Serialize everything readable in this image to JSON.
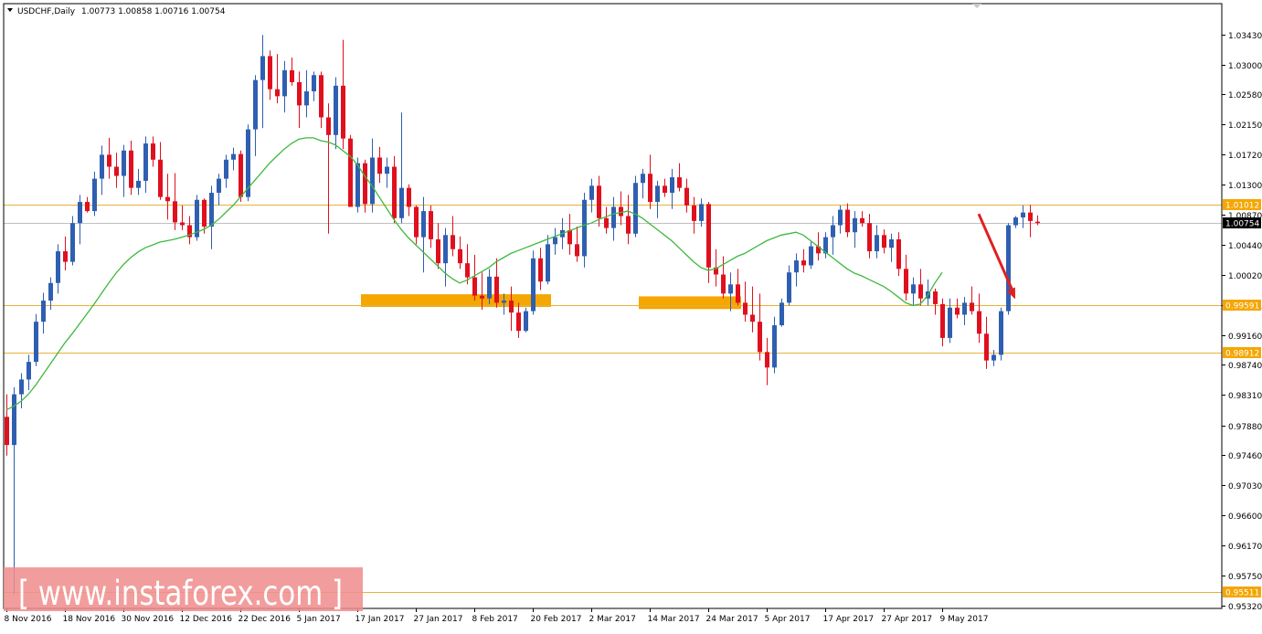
{
  "colors": {
    "bull": "#2f5fb0",
    "bear": "#e0101e",
    "wick_bull": "#2f5fb0",
    "wick_bear": "#e0101e",
    "ma": "#3fb83f",
    "level_line": "#e8b23a",
    "level_label_bg": "#f5a600",
    "zone": "#f5a600",
    "arrow": "#e02020",
    "price_label_bg": "#000000",
    "watermark_bg": "#f08c8c"
  },
  "header": {
    "symbol_label": "USDCHF,Daily",
    "ohlc": "1.00773 1.00858 1.00716 1.00754"
  },
  "watermark": {
    "text": "[ www.instaforex.com ]"
  },
  "chart_data": {
    "type": "candlestick",
    "symbol": "USDCHF",
    "timeframe": "Daily",
    "ylim": [
      0.9532,
      1.0372
    ],
    "y_ticks": [
      "1.03430",
      "1.03000",
      "1.02580",
      "1.02150",
      "1.01720",
      "1.01300",
      "1.00870",
      "1.00440",
      "1.00020",
      "0.99591",
      "0.99160",
      "0.98740",
      "0.98310",
      "0.97880",
      "0.97460",
      "0.97030",
      "0.96600",
      "0.96170",
      "0.95750",
      "0.95320"
    ],
    "x_ticks": [
      "8 Nov 2016",
      "18 Nov 2016",
      "30 Nov 2016",
      "12 Dec 2016",
      "22 Dec 2016",
      "5 Jan 2017",
      "17 Jan 2017",
      "27 Jan 2017",
      "8 Feb 2017",
      "20 Feb 2017",
      "2 Mar 2017",
      "14 Mar 2017",
      "24 Mar 2017",
      "5 Apr 2017",
      "17 Apr 2017",
      "27 Apr 2017",
      "9 May 2017"
    ],
    "x_tick_index": [
      0,
      8,
      16,
      24,
      32,
      40,
      48,
      56,
      64,
      72,
      80,
      88,
      96,
      104,
      112,
      120,
      128
    ],
    "current_price": "1.00754",
    "current_price_value": 1.00754,
    "levels": [
      {
        "label": "1.01012",
        "value": 1.01012
      },
      {
        "label": "0.99591",
        "value": 0.99591
      },
      {
        "label": "0.98912",
        "value": 0.98912
      },
      {
        "label": "0.95511",
        "value": 0.95511
      }
    ],
    "zones": [
      {
        "from_index": 48.5,
        "to_index": 74.5,
        "low": 0.9956,
        "high": 0.9974
      },
      {
        "from_index": 86.5,
        "to_index": 100.5,
        "low": 0.9953,
        "high": 0.9971
      }
    ],
    "arrow": {
      "from_index": 133,
      "from_price": 1.0088,
      "to_index": 138,
      "to_price": 0.9967
    },
    "candles": [
      [
        0.98,
        0.9832,
        0.9745,
        0.976
      ],
      [
        0.976,
        0.9842,
        0.9548,
        0.9832
      ],
      [
        0.9832,
        0.9862,
        0.9812,
        0.9853
      ],
      [
        0.9853,
        0.9888,
        0.9838,
        0.9878
      ],
      [
        0.9878,
        0.9946,
        0.9872,
        0.9935
      ],
      [
        0.9935,
        0.9976,
        0.9918,
        0.9965
      ],
      [
        0.9965,
        0.9998,
        0.9952,
        0.999
      ],
      [
        0.999,
        1.0045,
        0.9975,
        1.0035
      ],
      [
        1.0035,
        1.0056,
        1.0008,
        1.002
      ],
      [
        1.002,
        1.0085,
        1.0015,
        1.0075
      ],
      [
        1.0075,
        1.0115,
        1.0045,
        1.0105
      ],
      [
        1.0105,
        1.0112,
        1.009,
        1.0092
      ],
      [
        1.0092,
        1.0148,
        1.0085,
        1.0138
      ],
      [
        1.0138,
        1.0185,
        1.0115,
        1.0172
      ],
      [
        1.0172,
        1.0196,
        1.0138,
        1.0155
      ],
      [
        1.0155,
        1.0175,
        1.0125,
        1.0142
      ],
      [
        1.0142,
        1.0186,
        1.0112,
        1.0178
      ],
      [
        1.0178,
        1.0192,
        1.0115,
        1.0125
      ],
      [
        1.0125,
        1.0152,
        1.0115,
        1.0135
      ],
      [
        1.0135,
        1.0198,
        1.0118,
        1.0188
      ],
      [
        1.0188,
        1.0198,
        1.0155,
        1.0165
      ],
      [
        1.0165,
        1.019,
        1.0108,
        1.0112
      ],
      [
        1.0112,
        1.0145,
        1.008,
        1.0106
      ],
      [
        1.0106,
        1.0146,
        1.0065,
        1.0076
      ],
      [
        1.0076,
        1.01,
        1.0065,
        1.0072
      ],
      [
        1.0072,
        1.0085,
        1.0045,
        1.0055
      ],
      [
        1.0055,
        1.0115,
        1.005,
        1.0108
      ],
      [
        1.0108,
        1.011,
        1.006,
        1.007
      ],
      [
        1.007,
        1.0128,
        1.0038,
        1.0118
      ],
      [
        1.0118,
        1.0145,
        1.01,
        1.0138
      ],
      [
        1.0138,
        1.0172,
        1.0125,
        1.0165
      ],
      [
        1.0165,
        1.0182,
        1.015,
        1.0173
      ],
      [
        1.0173,
        1.0178,
        1.0105,
        1.0112
      ],
      [
        1.0112,
        1.0215,
        1.0106,
        1.0208
      ],
      [
        1.0208,
        1.0285,
        1.017,
        1.0278
      ],
      [
        1.0278,
        1.0342,
        1.021,
        1.0312
      ],
      [
        1.0312,
        1.032,
        1.025,
        1.0265
      ],
      [
        1.0265,
        1.0315,
        1.0245,
        1.0255
      ],
      [
        1.0255,
        1.0305,
        1.0232,
        1.0292
      ],
      [
        1.0292,
        1.031,
        1.027,
        1.0275
      ],
      [
        1.0275,
        1.029,
        1.021,
        1.0242
      ],
      [
        1.0242,
        1.0292,
        1.0225,
        1.0262
      ],
      [
        1.0262,
        1.029,
        1.0248,
        1.0285
      ],
      [
        1.0285,
        1.029,
        1.021,
        1.0225
      ],
      [
        1.0225,
        1.0245,
        1.006,
        1.02
      ],
      [
        1.02,
        1.0282,
        1.018,
        1.027
      ],
      [
        1.027,
        1.0335,
        1.018,
        1.0195
      ],
      [
        1.0195,
        1.02,
        1.0102,
        1.0098
      ],
      [
        1.0098,
        1.0168,
        1.009,
        1.016
      ],
      [
        1.016,
        1.0165,
        1.009,
        1.0102
      ],
      [
        1.0102,
        1.0195,
        1.009,
        1.0168
      ],
      [
        1.0168,
        1.0183,
        1.0132,
        1.0145
      ],
      [
        1.0145,
        1.0168,
        1.0125,
        1.0155
      ],
      [
        1.0155,
        1.017,
        1.0075,
        1.0082
      ],
      [
        1.0082,
        1.0232,
        1.0075,
        1.0125
      ],
      [
        1.0125,
        1.013,
        1.0085,
        1.0098
      ],
      [
        1.0098,
        1.01,
        1.0045,
        1.0055
      ],
      [
        1.0055,
        1.0112,
        1.0005,
        1.0092
      ],
      [
        1.0092,
        1.01,
        1.004,
        1.0052
      ],
      [
        1.0052,
        1.0075,
        1.001,
        1.0018
      ],
      [
        1.0018,
        1.0068,
        0.9985,
        1.0058
      ],
      [
        1.0058,
        1.0085,
        1.0028,
        1.0038
      ],
      [
        1.0038,
        1.0056,
        1.001,
        1.0018
      ],
      [
        1.0018,
        1.0045,
        0.9988,
        0.9998
      ],
      [
        0.9998,
        1.003,
        0.9965,
        0.9972
      ],
      [
        0.9972,
        1.0005,
        0.9952,
        0.9968
      ],
      [
        0.9968,
        1.001,
        0.996,
        0.9999
      ],
      [
        0.9999,
        1.0025,
        0.9955,
        0.9962
      ],
      [
        0.9962,
        0.9975,
        0.9945,
        0.9965
      ],
      [
        0.9965,
        0.9985,
        0.9922,
        0.9948
      ],
      [
        0.9948,
        0.9962,
        0.9912,
        0.9922
      ],
      [
        0.9922,
        0.9955,
        0.992,
        0.995
      ],
      [
        0.995,
        1.0036,
        0.9945,
        1.0025
      ],
      [
        1.0025,
        1.004,
        0.998,
        0.9992
      ],
      [
        0.9992,
        1.0058,
        0.9988,
        1.0045
      ],
      [
        1.0045,
        1.0068,
        1.003,
        1.0055
      ],
      [
        1.0055,
        1.0082,
        1.0038,
        1.0065
      ],
      [
        1.0065,
        1.0088,
        1.003,
        1.0045
      ],
      [
        1.0045,
        1.007,
        1.002,
        1.0028
      ],
      [
        1.0028,
        1.0118,
        1.0012,
        1.0108
      ],
      [
        1.0108,
        1.0138,
        1.009,
        1.0128
      ],
      [
        1.0128,
        1.0142,
        1.007,
        1.0082
      ],
      [
        1.0082,
        1.0098,
        1.006,
        1.0068
      ],
      [
        1.0068,
        1.0112,
        1.005,
        1.0098
      ],
      [
        1.0098,
        1.012,
        1.0072,
        1.0085
      ],
      [
        1.0085,
        1.0115,
        1.0045,
        1.006
      ],
      [
        1.006,
        1.0142,
        1.0055,
        1.0132
      ],
      [
        1.0132,
        1.0152,
        1.011,
        1.0145
      ],
      [
        1.0145,
        1.0172,
        1.0095,
        1.0105
      ],
      [
        1.0105,
        1.0135,
        1.0082,
        1.0128
      ],
      [
        1.0128,
        1.0138,
        1.0112,
        1.0118
      ],
      [
        1.0118,
        1.0152,
        1.0095,
        1.014
      ],
      [
        1.014,
        1.016,
        1.012,
        1.0125
      ],
      [
        1.0125,
        1.0138,
        1.009,
        1.01
      ],
      [
        1.01,
        1.0112,
        1.006,
        1.0078
      ],
      [
        1.0078,
        1.011,
        1.007,
        1.0102
      ],
      [
        1.0102,
        1.0105,
        0.999,
        1.0012
      ],
      [
        1.0012,
        1.0038,
        0.9985,
        1.0002
      ],
      [
        1.0002,
        1.0028,
        0.9968,
        0.9975
      ],
      [
        0.9975,
        1.0005,
        0.995,
        0.9988
      ],
      [
        0.9988,
        1.001,
        0.9958,
        0.9962
      ],
      [
        0.9962,
        0.9992,
        0.9935,
        0.9945
      ],
      [
        0.9945,
        0.9985,
        0.992,
        0.9935
      ],
      [
        0.9935,
        0.9975,
        0.988,
        0.9892
      ],
      [
        0.9892,
        0.9912,
        0.9845,
        0.987
      ],
      [
        0.987,
        0.9942,
        0.9862,
        0.993
      ],
      [
        0.993,
        0.9968,
        0.9928,
        0.9962
      ],
      [
        0.9962,
        1.0015,
        0.9958,
        1.0005
      ],
      [
        1.0005,
        1.0032,
        0.9985,
        1.0022
      ],
      [
        1.0022,
        1.0038,
        1.0005,
        1.0015
      ],
      [
        1.0015,
        1.005,
        1.001,
        1.0042
      ],
      [
        1.0042,
        1.0062,
        1.0022,
        1.0032
      ],
      [
        1.0032,
        1.0062,
        1.0025,
        1.0055
      ],
      [
        1.0055,
        1.0085,
        1.003,
        1.0072
      ],
      [
        1.0072,
        1.01,
        1.006,
        1.0094
      ],
      [
        1.0094,
        1.0103,
        1.0055,
        1.0062
      ],
      [
        1.0062,
        1.0092,
        1.004,
        1.0082
      ],
      [
        1.0082,
        1.0092,
        1.007,
        1.0075
      ],
      [
        1.0075,
        1.0088,
        1.0025,
        1.0035
      ],
      [
        1.0035,
        1.0072,
        1.0025,
        1.0058
      ],
      [
        1.0058,
        1.0066,
        1.0032,
        1.004
      ],
      [
        1.004,
        1.006,
        1.002,
        1.0052
      ],
      [
        1.0052,
        1.0062,
        1.0,
        1.001
      ],
      [
        1.001,
        1.003,
        0.9965,
        0.9975
      ],
      [
        0.9975,
        0.9998,
        0.9958,
        0.9988
      ],
      [
        0.9988,
        1.001,
        0.9958,
        0.9968
      ],
      [
        0.9968,
        0.9995,
        0.9958,
        0.9978
      ],
      [
        0.9978,
        0.9982,
        0.9945,
        0.996
      ],
      [
        0.996,
        0.9968,
        0.99,
        0.9912
      ],
      [
        0.9912,
        0.9968,
        0.9905,
        0.9955
      ],
      [
        0.9955,
        0.9968,
        0.994,
        0.9945
      ],
      [
        0.9945,
        0.997,
        0.993,
        0.9962
      ],
      [
        0.9962,
        0.9985,
        0.9945,
        0.995
      ],
      [
        0.995,
        0.9975,
        0.9905,
        0.9918
      ],
      [
        0.9918,
        0.9942,
        0.9868,
        0.988
      ],
      [
        0.988,
        0.9895,
        0.9872,
        0.9888
      ],
      [
        0.9888,
        0.9955,
        0.988,
        0.995
      ],
      [
        0.995,
        1.0075,
        0.9945,
        1.0072
      ],
      [
        1.0072,
        1.0085,
        1.0068,
        1.0083
      ],
      [
        1.0083,
        1.01,
        1.0068,
        1.009
      ],
      [
        1.009,
        1.0101,
        1.0055,
        1.0078
      ],
      [
        1.0077,
        1.0086,
        1.0072,
        1.0075
      ]
    ],
    "ma": [
      0.981,
      0.9815,
      0.9822,
      0.9832,
      0.9845,
      0.986,
      0.9875,
      0.989,
      0.9905,
      0.9918,
      0.9932,
      0.9946,
      0.996,
      0.9975,
      0.999,
      1.0004,
      1.0016,
      1.0026,
      1.0034,
      1.004,
      1.0044,
      1.0048,
      1.005,
      1.0052,
      1.0055,
      1.0058,
      1.0062,
      1.0066,
      1.0072,
      1.008,
      1.009,
      1.01,
      1.0112,
      1.0124,
      1.0136,
      1.0148,
      1.016,
      1.017,
      1.018,
      1.0188,
      1.0194,
      1.0196,
      1.0196,
      1.0192,
      1.019,
      1.0186,
      1.0178,
      1.017,
      1.0158,
      1.0142,
      1.0128,
      1.0112,
      1.0096,
      1.008,
      1.0066,
      1.0054,
      1.0044,
      1.0034,
      1.0024,
      1.0014,
      1.0004,
      0.9996,
      0.999,
      0.9994,
      1.0,
      1.0006,
      1.0012,
      1.002,
      1.0026,
      1.0032,
      1.0036,
      1.004,
      1.0044,
      1.0048,
      1.0052,
      1.0056,
      1.006,
      1.0064,
      1.0068,
      1.0072,
      1.0075,
      1.008,
      1.0084,
      1.0088,
      1.009,
      1.0092,
      1.0088,
      1.0082,
      1.0074,
      1.0066,
      1.0058,
      1.005,
      1.004,
      1.003,
      1.002,
      1.0012,
      1.0008,
      1.001,
      1.0016,
      1.0022,
      1.0028,
      1.0032,
      1.0038,
      1.0044,
      1.005,
      1.0054,
      1.0058,
      1.006,
      1.0062,
      1.0058,
      1.005,
      1.0042,
      1.0034,
      1.0026,
      1.0018,
      1.001,
      1.0004,
      1.0,
      0.9995,
      0.999,
      0.9985,
      0.9978,
      0.997,
      0.9962,
      0.9958,
      0.996,
      0.9972,
      0.999,
      1.0005
    ]
  }
}
